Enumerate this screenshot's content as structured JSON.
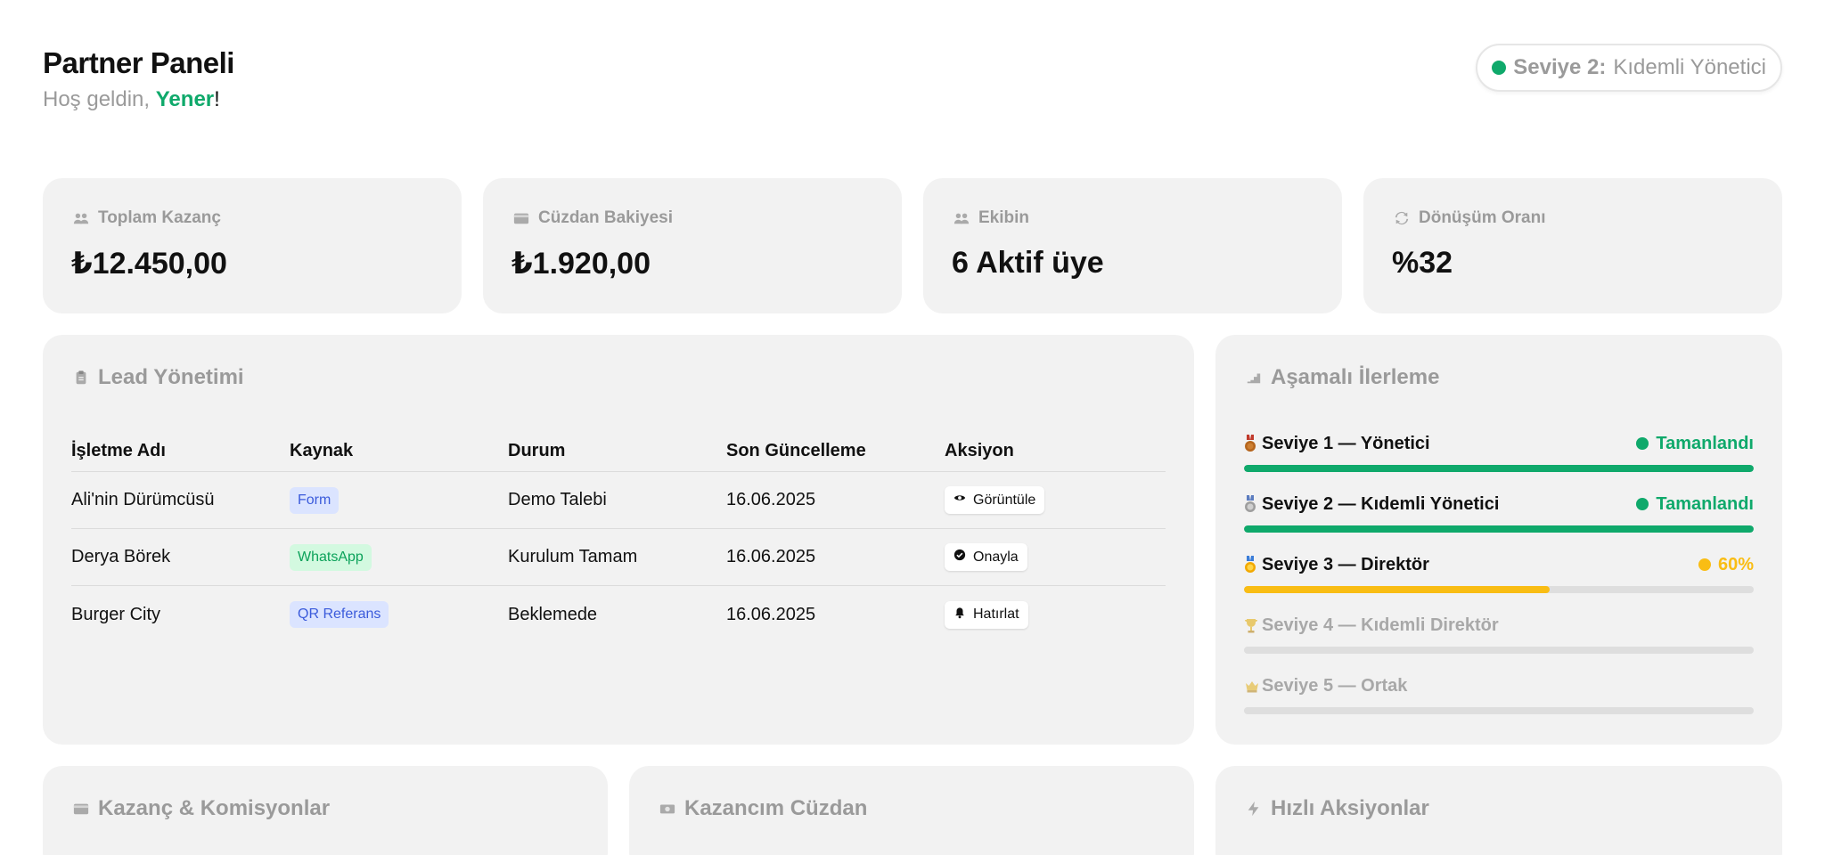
{
  "header": {
    "title": "Partner Paneli",
    "greeting_prefix": "Hoş geldin, ",
    "user_name": "Yener",
    "greeting_suffix": "!"
  },
  "level_badge": {
    "key": "Seviye 2:",
    "value": "Kıdemli Yönetici",
    "dot_color": "#0fa96b"
  },
  "stats": [
    {
      "icon": "users-icon",
      "label": "Toplam Kazanç",
      "value": "₺12.450,00"
    },
    {
      "icon": "wallet-icon",
      "label": "Cüzdan Bakiyesi",
      "value": "₺1.920,00"
    },
    {
      "icon": "users-icon",
      "label": "Ekibin",
      "value": "6 Aktif üye"
    },
    {
      "icon": "refresh-icon",
      "label": "Dönüşüm Oranı",
      "value": "%32"
    }
  ],
  "lead_management": {
    "title": "Lead Yönetimi",
    "icon": "clipboard-icon",
    "columns": [
      "İşletme Adı",
      "Kaynak",
      "Durum",
      "Son Güncelleme",
      "Aksiyon"
    ],
    "rows": [
      {
        "name": "Ali'nin Dürümcüsü",
        "source": "Form",
        "source_bg": "#dbe4ff",
        "source_color": "#3b5bdb",
        "status": "Demo Talebi",
        "updated": "16.06.2025",
        "action": "Görüntüle",
        "action_icon": "eye-icon"
      },
      {
        "name": "Derya Börek",
        "source": "WhatsApp",
        "source_bg": "#d3f9e0",
        "source_color": "#0ca25a",
        "status": "Kurulum Tamam",
        "updated": "16.06.2025",
        "action": "Onayla",
        "action_icon": "check-circle-icon"
      },
      {
        "name": "Burger City",
        "source": "QR Referans",
        "source_bg": "#dbe4ff",
        "source_color": "#3b5bdb",
        "status": "Beklemede",
        "updated": "16.06.2025",
        "action": "Hatırlat",
        "action_icon": "bell-icon"
      }
    ]
  },
  "progress": {
    "title": "Aşamalı İlerleme",
    "icon": "stairs-icon",
    "levels": [
      {
        "icon": "bronze-medal-icon",
        "name": "Seviye 1 — Yönetici",
        "status": "Tamanlandı",
        "progress": 1.0,
        "color": "#0fa96b",
        "active": true
      },
      {
        "icon": "silver-medal-icon",
        "name": "Seviye 2 — Kıdemli Yönetici",
        "status": "Tamanlandı",
        "progress": 1.0,
        "color": "#0fa96b",
        "active": true
      },
      {
        "icon": "gold-medal-icon",
        "name": "Seviye 3 — Direktör",
        "status": "60%",
        "progress": 0.6,
        "color": "#f9bd14",
        "active": true
      },
      {
        "icon": "trophy-icon",
        "name": "Seviye 4 — Kıdemli Direktör",
        "status": "",
        "progress": 0,
        "color": "#dedede",
        "active": false
      },
      {
        "icon": "crown-icon",
        "name": "Seviye 5 — Ortak",
        "status": "",
        "progress": 0,
        "color": "#dedede",
        "active": false
      }
    ]
  },
  "bottom_cards": [
    {
      "icon": "wallet-icon",
      "title": "Kazanç & Komisyonlar"
    },
    {
      "icon": "money-icon",
      "title": "Kazancım Cüzdan"
    },
    {
      "icon": "bolt-icon",
      "title": "Hızlı Aksiyonlar"
    }
  ]
}
